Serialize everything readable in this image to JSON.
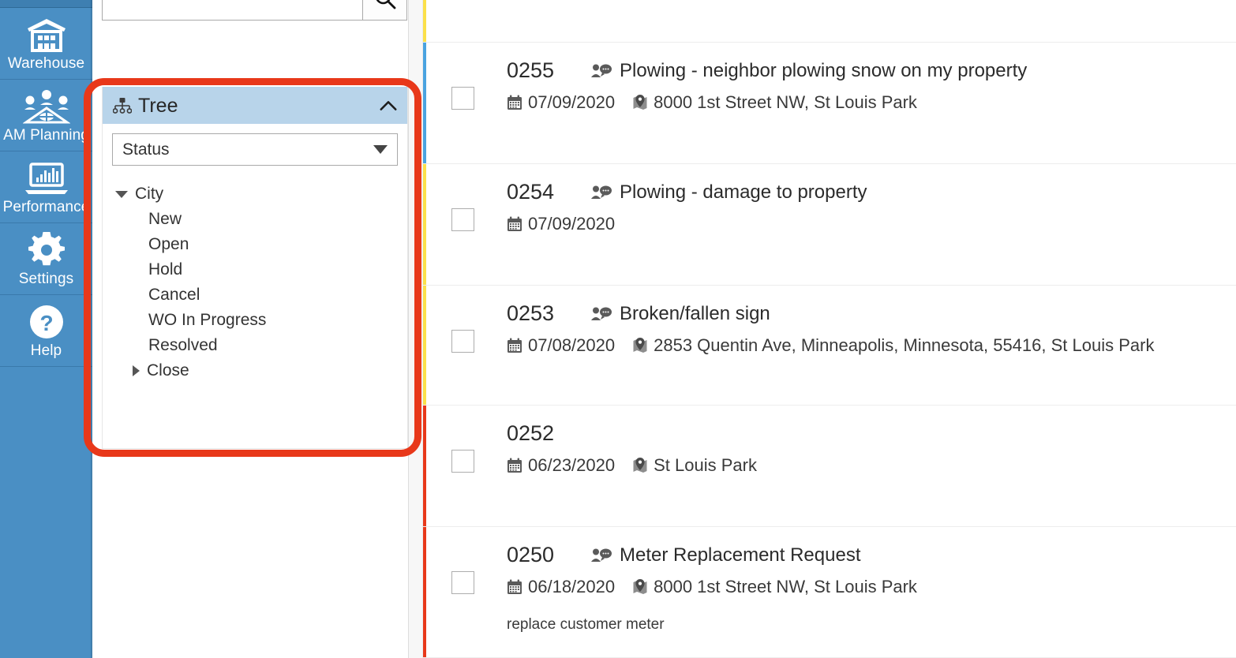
{
  "sidebar": {
    "items": [
      {
        "label": "Warehouse",
        "icon": "warehouse-icon"
      },
      {
        "label": "AM Planning",
        "icon": "am-planning-icon"
      },
      {
        "label": "Performance",
        "icon": "performance-icon"
      },
      {
        "label": "Settings",
        "icon": "gear-icon"
      },
      {
        "label": "Help",
        "icon": "help-icon"
      }
    ],
    "background_color": "#4a8fc4"
  },
  "search": {
    "value": "",
    "placeholder": "",
    "button_icon": "search-icon"
  },
  "tree_panel": {
    "title": "Tree",
    "header_icon": "sitemap-icon",
    "collapse_icon": "chevron-up-icon",
    "header_color": "#b8d4ea",
    "dropdown": {
      "selected": "Status",
      "caret_icon": "caret-down-icon"
    },
    "nodes": [
      {
        "label": "City",
        "level": 0,
        "state": "expanded"
      },
      {
        "label": "New",
        "level": 1,
        "state": "leaf"
      },
      {
        "label": "Open",
        "level": 1,
        "state": "leaf"
      },
      {
        "label": "Hold",
        "level": 1,
        "state": "leaf"
      },
      {
        "label": "Cancel",
        "level": 1,
        "state": "leaf"
      },
      {
        "label": "WO In Progress",
        "level": 1,
        "state": "leaf"
      },
      {
        "label": "Resolved",
        "level": 1,
        "state": "leaf"
      },
      {
        "label": "Close",
        "level": 1,
        "state": "collapsed"
      }
    ]
  },
  "highlight": {
    "color": "#e8381a"
  },
  "list": {
    "rows": [
      {
        "partial": true,
        "stripe_color": "#fbe04a"
      },
      {
        "id": "0255",
        "title": "Plowing - neighbor plowing snow on my property",
        "title_icon": "user-comment-icon",
        "date": "07/09/2020",
        "date_icon": "calendar-icon",
        "location": "8000 1st Street NW, St Louis Park",
        "location_icon": "map-marker-icon",
        "description": "",
        "stripe_color": "#4aa3e0",
        "checked": false
      },
      {
        "id": "0254",
        "title": "Plowing - damage to property",
        "title_icon": "user-comment-icon",
        "date": "07/09/2020",
        "date_icon": "calendar-icon",
        "location": "",
        "location_icon": "map-marker-icon",
        "description": "",
        "stripe_color": "#fbe04a",
        "checked": false
      },
      {
        "id": "0253",
        "title": "Broken/fallen sign",
        "title_icon": "user-comment-icon",
        "date": "07/08/2020",
        "date_icon": "calendar-icon",
        "location": "2853 Quentin Ave, Minneapolis, Minnesota, 55416, St Louis Park",
        "location_icon": "map-marker-icon",
        "description": "",
        "stripe_color": "#fbe04a",
        "checked": false
      },
      {
        "id": "0252",
        "title": "",
        "title_icon": "",
        "date": "06/23/2020",
        "date_icon": "calendar-icon",
        "location": "St Louis Park",
        "location_icon": "map-marker-icon",
        "description": "",
        "stripe_color": "#e8381a",
        "checked": false
      },
      {
        "id": "0250",
        "title": "Meter Replacement Request",
        "title_icon": "user-comment-icon",
        "date": "06/18/2020",
        "date_icon": "calendar-icon",
        "location": "8000 1st Street NW, St Louis Park",
        "location_icon": "map-marker-icon",
        "description": "replace customer meter",
        "stripe_color": "#e8381a",
        "checked": false
      }
    ]
  }
}
